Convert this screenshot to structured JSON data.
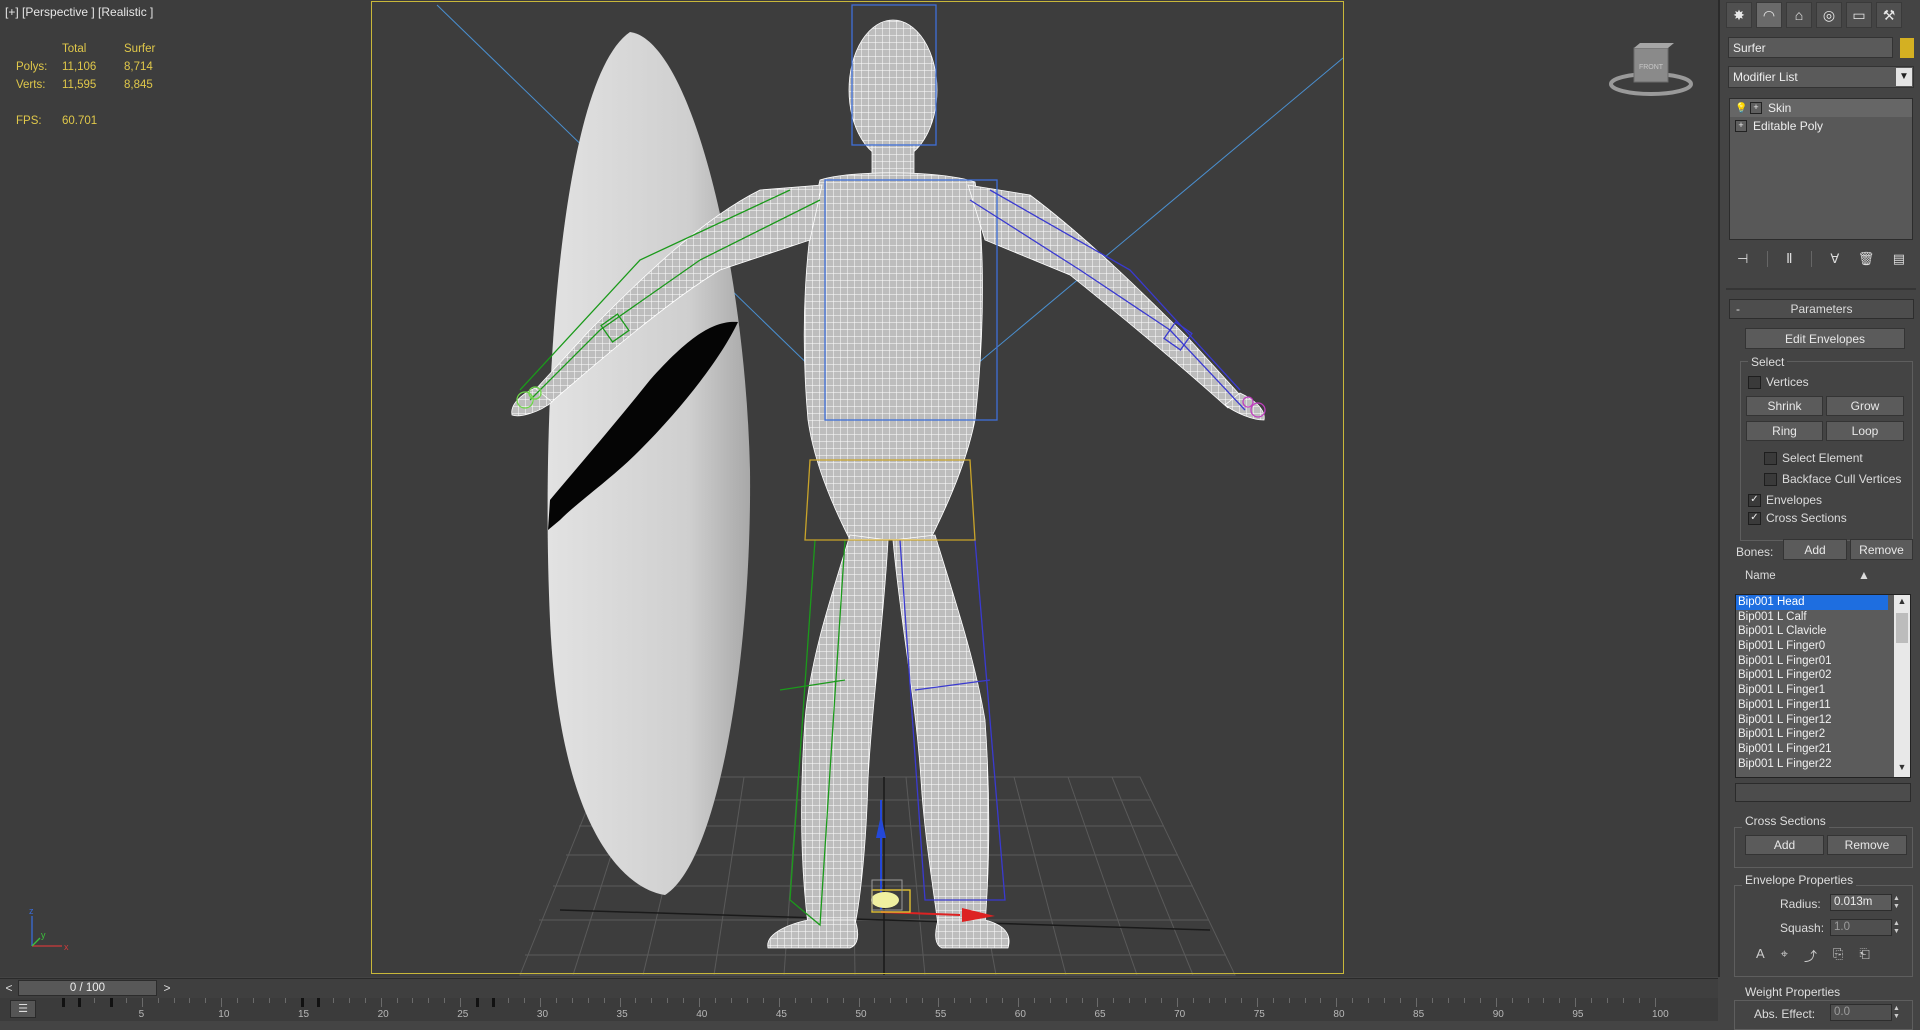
{
  "viewport": {
    "label": "[+] [Perspective ] [Realistic ]",
    "stats": {
      "col_total": "Total",
      "col_object": "Surfer",
      "polys_label": "Polys:",
      "polys_total": "11,106",
      "polys_object": "8,714",
      "verts_label": "Verts:",
      "verts_total": "11,595",
      "verts_object": "8,845",
      "fps_label": "FPS:",
      "fps_value": "60.701"
    },
    "viewcube_label": "FRONT",
    "axis": {
      "x": "x",
      "y": "y",
      "z": "z"
    }
  },
  "panel": {
    "tabs": [
      {
        "name": "create-tab",
        "glyph": "✸"
      },
      {
        "name": "modify-tab",
        "glyph": "◠"
      },
      {
        "name": "hierarchy-tab",
        "glyph": "⌂"
      },
      {
        "name": "motion-tab",
        "glyph": "◎"
      },
      {
        "name": "display-tab",
        "glyph": "▭"
      },
      {
        "name": "utilities-tab",
        "glyph": "⚒"
      }
    ],
    "object_name": "Surfer",
    "object_color": "#d4b022",
    "modifier_list": "Modifier List",
    "stack": [
      {
        "label": "Skin"
      },
      {
        "label": "Editable Poly"
      }
    ],
    "parameters": {
      "title": "Parameters",
      "collapse": "-",
      "edit_envelopes": "Edit Envelopes",
      "select_group": "Select",
      "vertices": "Vertices",
      "shrink": "Shrink",
      "grow": "Grow",
      "ring": "Ring",
      "loop": "Loop",
      "select_element": "Select Element",
      "backface_cull": "Backface Cull Vertices",
      "envelopes": "Envelopes",
      "cross_sections": "Cross Sections",
      "bones_label": "Bones:",
      "bones_add": "Add",
      "bones_remove": "Remove",
      "name_header": "Name",
      "bones": [
        "Bip001 Head",
        "Bip001 L Calf",
        "Bip001 L Clavicle",
        "Bip001 L Finger0",
        "Bip001 L Finger01",
        "Bip001 L Finger02",
        "Bip001 L Finger1",
        "Bip001 L Finger11",
        "Bip001 L Finger12",
        "Bip001 L Finger2",
        "Bip001 L Finger21",
        "Bip001 L Finger22"
      ],
      "cross_sections_group": "Cross Sections",
      "cs_add": "Add",
      "cs_remove": "Remove",
      "envelope_props_group": "Envelope Properties",
      "radius_label": "Radius:",
      "radius_value": "0.013m",
      "squash_label": "Squash:",
      "squash_value": "1.0",
      "weight_props_group": "Weight Properties",
      "abs_effect_label": "Abs. Effect:",
      "abs_effect_value": "0.0"
    }
  },
  "timeline": {
    "frame_display": "0 / 100",
    "prev": "<",
    "next": ">",
    "ticks": [
      "5",
      "10",
      "15",
      "20",
      "25",
      "30",
      "35",
      "40",
      "45",
      "50",
      "55",
      "60",
      "65",
      "70",
      "75",
      "80",
      "85",
      "90",
      "95",
      "100"
    ]
  }
}
